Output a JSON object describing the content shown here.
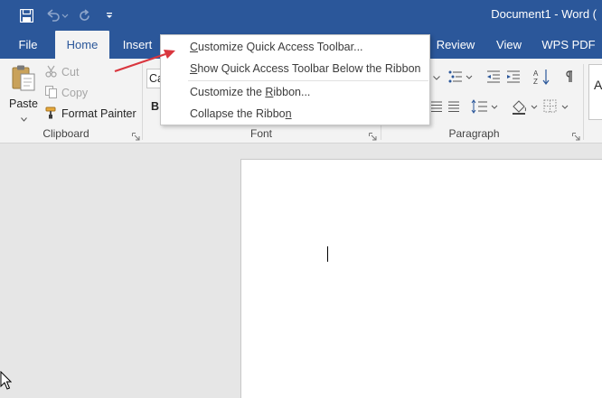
{
  "window": {
    "title": "Document1 - Word ("
  },
  "tabs": [
    {
      "id": "file",
      "label": "File"
    },
    {
      "id": "home",
      "label": "Home"
    },
    {
      "id": "insert",
      "label": "Insert"
    },
    {
      "id": "review",
      "label": "Review"
    },
    {
      "id": "view",
      "label": "View"
    },
    {
      "id": "wps-pdf",
      "label": "WPS PDF"
    }
  ],
  "ribbon": {
    "clipboard": {
      "label": "Clipboard",
      "paste": "Paste",
      "cut": "Cut",
      "copy": "Copy",
      "format_painter": "Format Painter"
    },
    "font": {
      "label": "Font",
      "font_name_partial": "Ca",
      "bold": "B"
    },
    "paragraph": {
      "label": "Paragraph"
    },
    "styles": {
      "partial": "A"
    }
  },
  "context_menu": {
    "items": [
      {
        "id": "customize-qat",
        "pre": "",
        "key": "C",
        "post": "ustomize Quick Access Toolbar..."
      },
      {
        "id": "show-qat-below",
        "pre": "",
        "key": "S",
        "post": "how Quick Access Toolbar Below the Ribbon"
      },
      {
        "id": "customize-ribbon",
        "pre": "Customize the ",
        "key": "R",
        "post": "ibbon..."
      },
      {
        "id": "collapse-ribbon",
        "pre": "Collapse the Ribbo",
        "key": "n",
        "post": ""
      }
    ]
  },
  "colors": {
    "accent": "#2b579a",
    "ribbon_bg": "#f3f3f3",
    "doc_bg": "#e6e6e6",
    "annotation_arrow": "#d9363e"
  }
}
